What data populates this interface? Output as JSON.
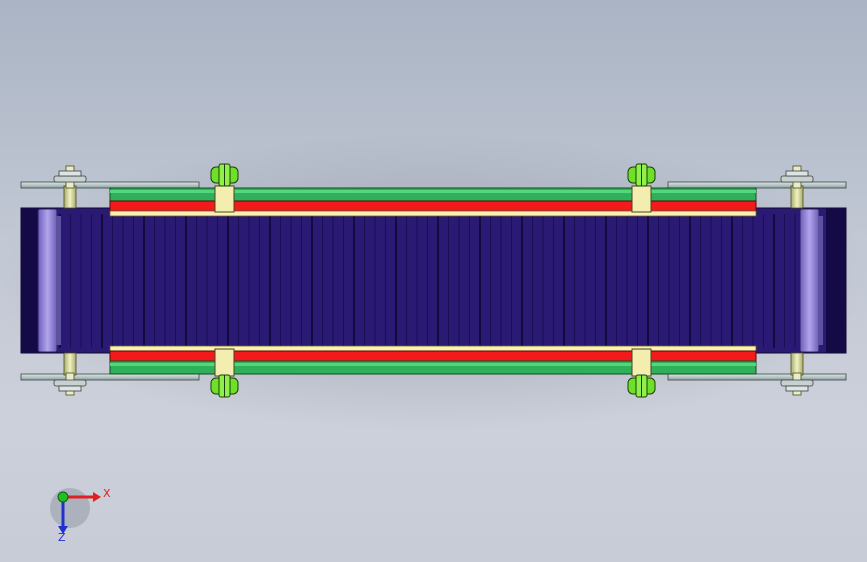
{
  "viewport": {
    "background_top": "#aab4c4",
    "background_bottom": "#c7ccd6"
  },
  "model": {
    "colors": {
      "belt": "#2a1a73",
      "belt_dark": "#140a45",
      "belt_slat_line": "#0d0830",
      "guide_green": "#2fb05a",
      "guide_red": "#f21a1a",
      "guide_cream": "#fff2b0",
      "bracket": "#f3eeb0",
      "roller_end": "#9888d8",
      "shaft_plate": "#b9c8c8",
      "shaft": "#d8dca0",
      "clamp_green": "#6fe02a"
    }
  },
  "triad": {
    "x_label": "X",
    "z_label": "Z",
    "x_color": "#e02020",
    "y_color": "#20c020",
    "z_color": "#2030d0"
  }
}
